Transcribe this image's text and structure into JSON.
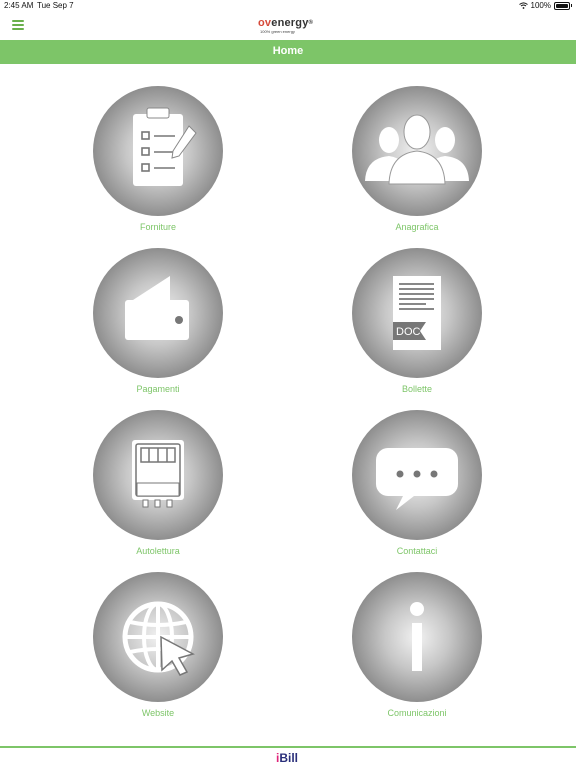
{
  "status_bar": {
    "time": "2:45 AM",
    "date": "Tue Sep 7",
    "battery": "100%"
  },
  "header": {
    "logo_prefix": "ov",
    "logo_suffix": "energy",
    "logo_mark": "®",
    "logo_tagline": "100% green energy",
    "menu_icon": "hamburger-icon"
  },
  "title_bar": {
    "title": "Home"
  },
  "tiles": [
    {
      "label": "Forniture",
      "icon": "clipboard-checklist-icon"
    },
    {
      "label": "Anagrafica",
      "icon": "people-group-icon"
    },
    {
      "label": "Pagamenti",
      "icon": "wallet-icon"
    },
    {
      "label": "Bollette",
      "icon": "document-icon",
      "icon_text": "DOC"
    },
    {
      "label": "Autolettura",
      "icon": "meter-icon"
    },
    {
      "label": "Contattaci",
      "icon": "chat-bubble-icon"
    },
    {
      "label": "Website",
      "icon": "globe-cursor-icon"
    },
    {
      "label": "Comunicazioni",
      "icon": "info-icon"
    }
  ],
  "footer": {
    "logo_prefix": "i",
    "logo_suffix": "Bill"
  },
  "colors": {
    "accent": "#7dc568",
    "circle_dark": "#6f6f6f",
    "brand_red": "#d64a3a",
    "footer_blue": "#2a2f7a"
  }
}
